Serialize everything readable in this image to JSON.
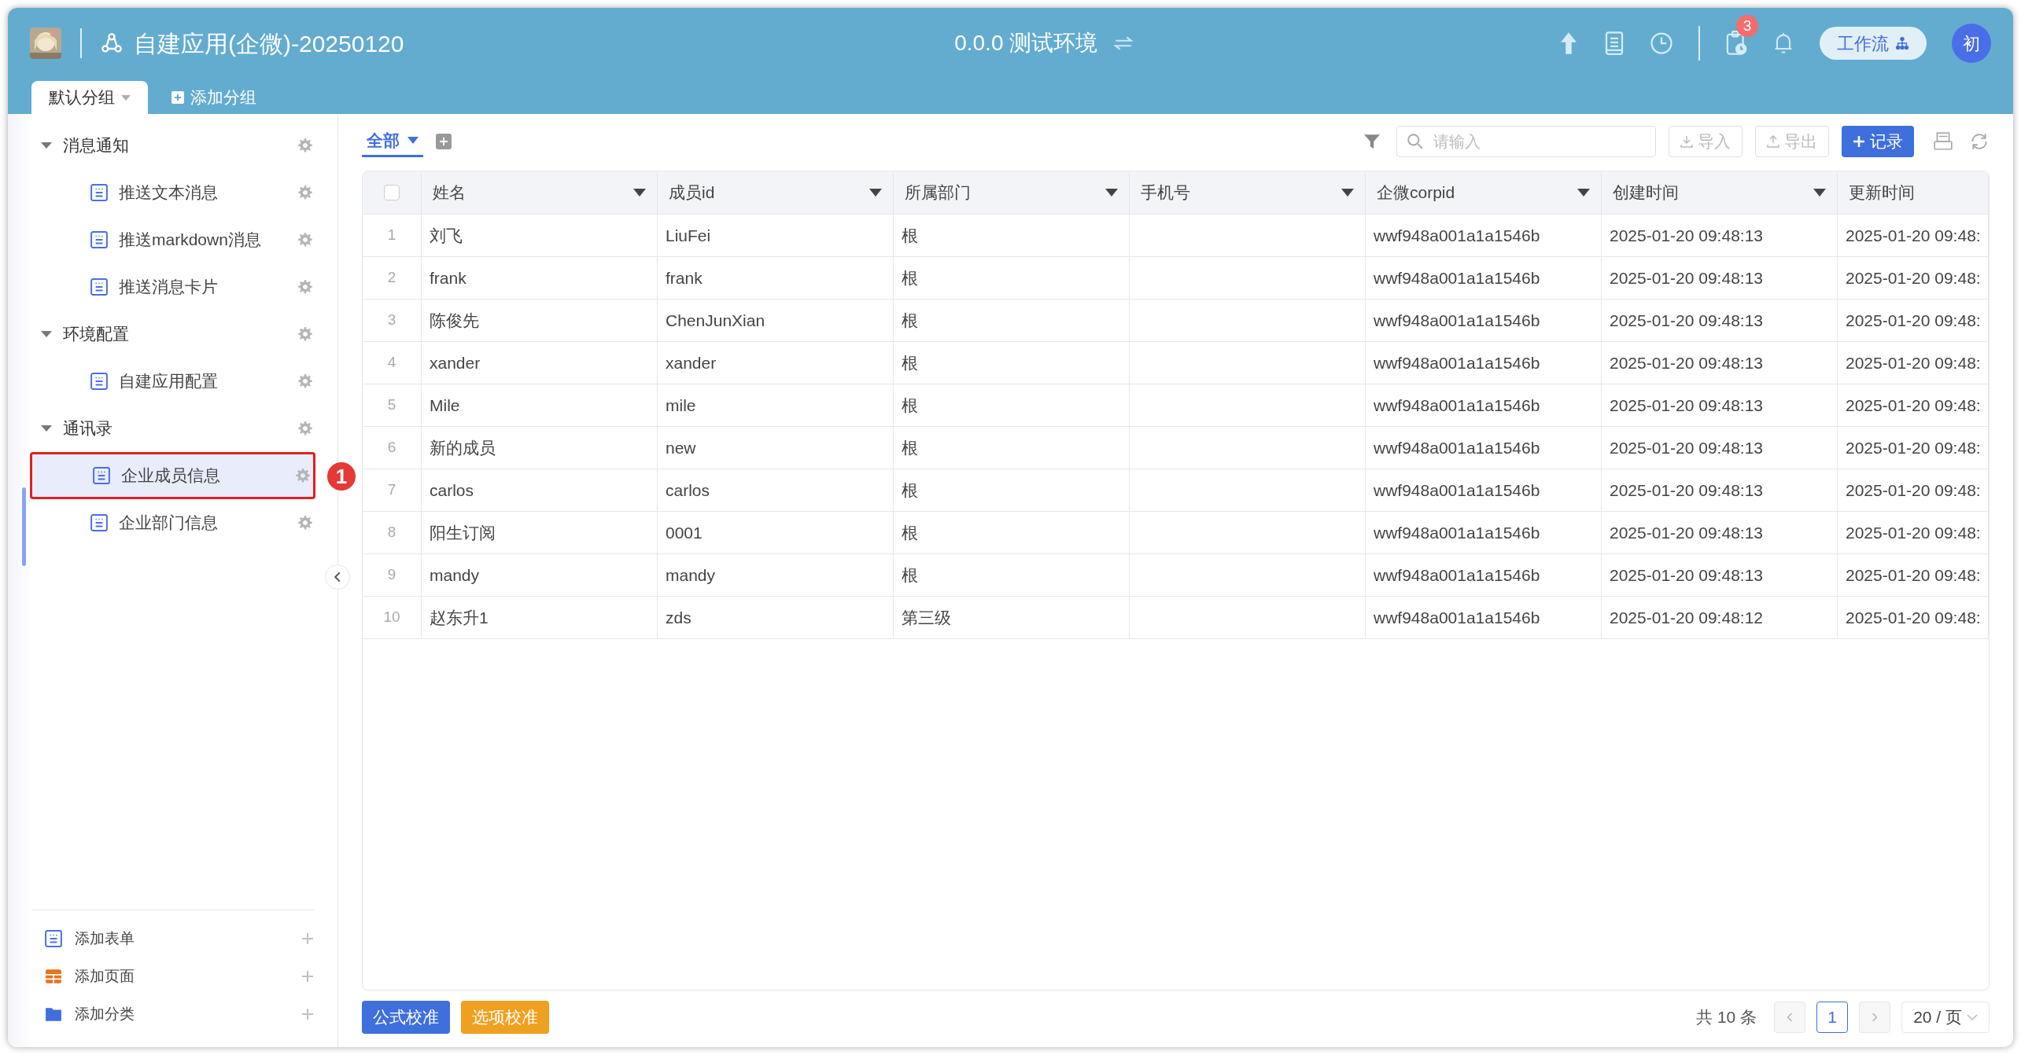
{
  "header": {
    "app_title": "自建应用(企微)-20250120",
    "environment": "0.0.0 测试环境",
    "notification_count": "3",
    "workflow_button": "工作流",
    "user_avatar": "初"
  },
  "group_tabs": [
    {
      "label": "默认分组",
      "selected": true
    }
  ],
  "add_group": "添加分组",
  "sidebar": {
    "groups": [
      {
        "label": "消息通知",
        "expanded": true,
        "children": [
          {
            "label": "推送文本消息",
            "selected": false
          },
          {
            "label": "推送markdown消息",
            "selected": false
          },
          {
            "label": "推送消息卡片",
            "selected": false
          }
        ]
      },
      {
        "label": "环境配置",
        "expanded": true,
        "children": [
          {
            "label": "自建应用配置",
            "selected": false
          }
        ]
      },
      {
        "label": "通讯录",
        "expanded": true,
        "children": [
          {
            "label": "企业成员信息",
            "selected": true
          },
          {
            "label": "企业部门信息",
            "selected": false
          }
        ]
      }
    ],
    "footer_actions": [
      {
        "kind": "form",
        "label": "添加表单"
      },
      {
        "kind": "page",
        "label": "添加页面"
      },
      {
        "kind": "category",
        "label": "添加分类"
      }
    ]
  },
  "annotation": {
    "label": "1"
  },
  "view_tabs": [
    {
      "label": "全部",
      "selected": true
    }
  ],
  "search": {
    "placeholder": "请输入"
  },
  "toolbar_buttons": [
    {
      "kind": "import",
      "label": "导入"
    },
    {
      "kind": "export",
      "label": "导出"
    },
    {
      "kind": "add",
      "label": "记录"
    }
  ],
  "table": {
    "select_all": {
      "checked": false
    },
    "columns": [
      {
        "label": "姓名",
        "menu": true
      },
      {
        "label": "成员id",
        "menu": true
      },
      {
        "label": "所属部门",
        "menu": true
      },
      {
        "label": "手机号",
        "menu": true
      },
      {
        "label": "企微corpid",
        "menu": true
      },
      {
        "label": "创建时间",
        "menu": true
      },
      {
        "label": "更新时间",
        "menu": false
      }
    ],
    "rows": [
      {
        "index": "1",
        "name": "刘飞",
        "member_id": "LiuFei",
        "department": "根",
        "corpid": "wwf948a001a1a1546b",
        "created_time": "2025-01-20 09:48:13",
        "updated_time": "2025-01-20 09:48:"
      },
      {
        "index": "2",
        "name": "frank",
        "member_id": "frank",
        "department": "根",
        "corpid": "wwf948a001a1a1546b",
        "created_time": "2025-01-20 09:48:13",
        "updated_time": "2025-01-20 09:48:"
      },
      {
        "index": "3",
        "name": "陈俊先",
        "member_id": "ChenJunXian",
        "department": "根",
        "corpid": "wwf948a001a1a1546b",
        "created_time": "2025-01-20 09:48:13",
        "updated_time": "2025-01-20 09:48:"
      },
      {
        "index": "4",
        "name": "xander",
        "member_id": "xander",
        "department": "根",
        "corpid": "wwf948a001a1a1546b",
        "created_time": "2025-01-20 09:48:13",
        "updated_time": "2025-01-20 09:48:"
      },
      {
        "index": "5",
        "name": "Mile",
        "member_id": "mile",
        "department": "根",
        "corpid": "wwf948a001a1a1546b",
        "created_time": "2025-01-20 09:48:13",
        "updated_time": "2025-01-20 09:48:"
      },
      {
        "index": "6",
        "name": "新的成员",
        "member_id": "new",
        "department": "根",
        "corpid": "wwf948a001a1a1546b",
        "created_time": "2025-01-20 09:48:13",
        "updated_time": "2025-01-20 09:48:"
      },
      {
        "index": "7",
        "name": "carlos",
        "member_id": "carlos",
        "department": "根",
        "corpid": "wwf948a001a1a1546b",
        "created_time": "2025-01-20 09:48:13",
        "updated_time": "2025-01-20 09:48:"
      },
      {
        "index": "8",
        "name": "阳生订阅",
        "member_id": "0001",
        "department": "根",
        "corpid": "wwf948a001a1a1546b",
        "created_time": "2025-01-20 09:48:13",
        "updated_time": "2025-01-20 09:48:"
      },
      {
        "index": "9",
        "name": "mandy",
        "member_id": "mandy",
        "department": "根",
        "corpid": "wwf948a001a1a1546b",
        "created_time": "2025-01-20 09:48:13",
        "updated_time": "2025-01-20 09:48:"
      },
      {
        "index": "10",
        "name": "赵东升1",
        "member_id": "zds",
        "department": "第三级",
        "corpid": "wwf948a001a1a1546b",
        "created_time": "2025-01-20 09:48:12",
        "updated_time": "2025-01-20 09:48:"
      }
    ]
  },
  "footer": {
    "buttons": [
      {
        "kind": "primary",
        "label": "公式校准"
      },
      {
        "kind": "warning",
        "label": "选项校准"
      }
    ],
    "total": "共 10 条",
    "pages": [
      {
        "label": "1",
        "selected": true
      }
    ],
    "page_size": "20 / 页"
  }
}
